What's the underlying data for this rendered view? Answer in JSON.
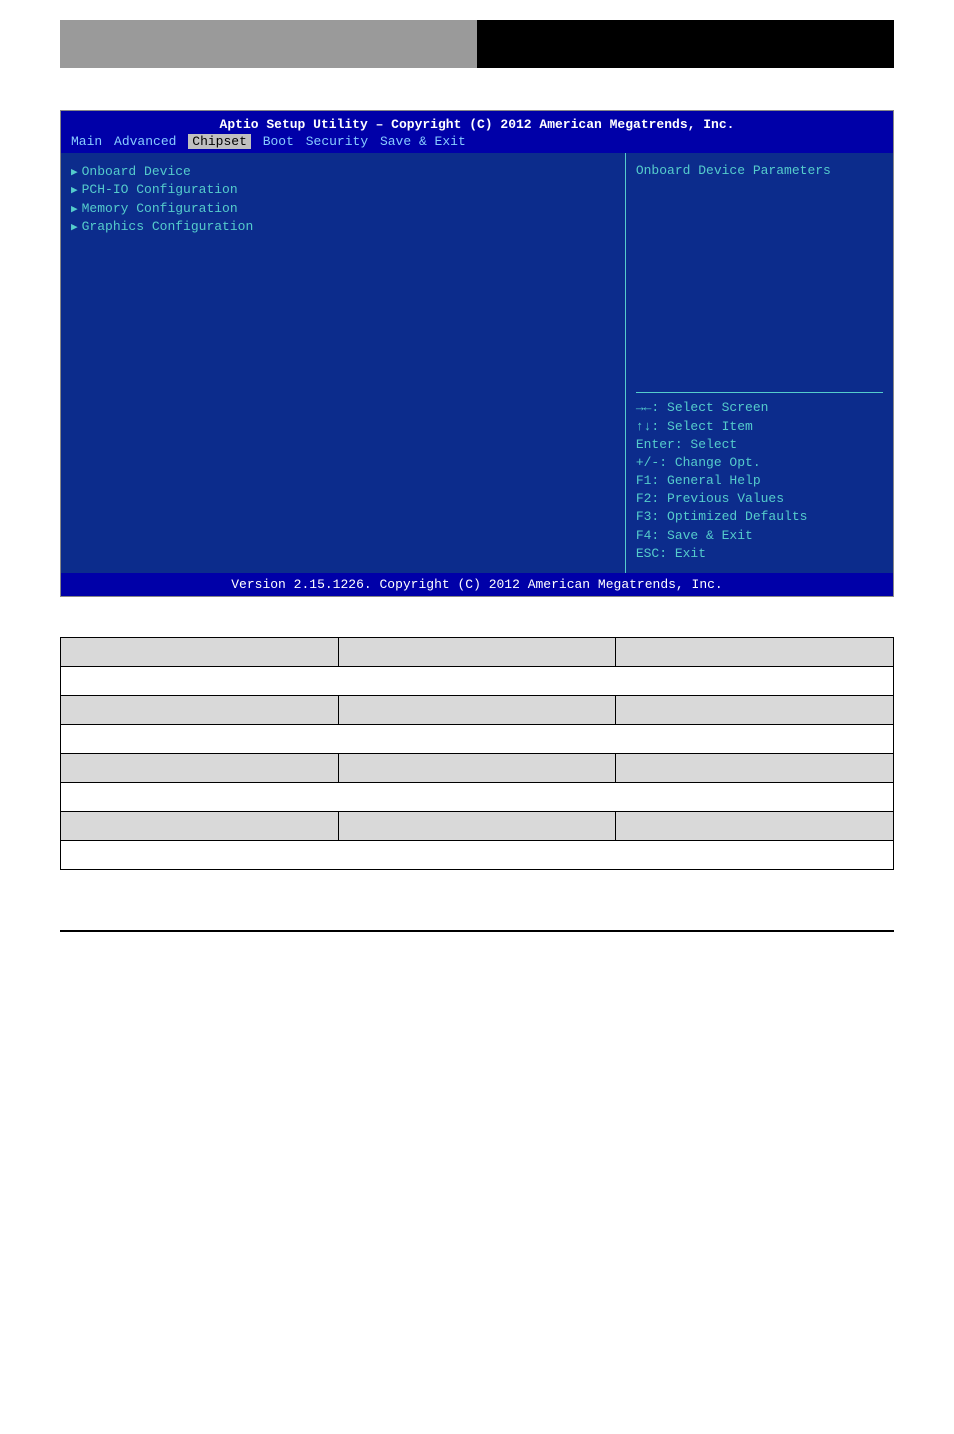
{
  "bios": {
    "title": "Aptio Setup Utility – Copyright (C) 2012 American Megatrends, Inc.",
    "menu": {
      "items": [
        "Main",
        "Advanced",
        "Chipset",
        "Boot",
        "Security",
        "Save & Exit"
      ],
      "active_index": 2
    },
    "left_items": [
      "Onboard Device",
      "PCH-IO Configuration",
      "Memory Configuration",
      "Graphics Configuration"
    ],
    "right_help": "Onboard Device Parameters",
    "keys": [
      "→←: Select Screen",
      "↑↓: Select Item",
      "Enter: Select",
      "+/-: Change Opt.",
      "F1: General Help",
      "F2: Previous Values",
      "F3: Optimized Defaults",
      "F4: Save & Exit",
      "ESC: Exit"
    ],
    "footer": "Version 2.15.1226. Copyright (C) 2012 American Megatrends, Inc."
  },
  "table": {
    "rows": [
      {
        "type": "header",
        "cells": [
          "",
          "",
          ""
        ]
      },
      {
        "type": "full",
        "cells": [
          ""
        ]
      },
      {
        "type": "header",
        "cells": [
          "",
          "",
          ""
        ]
      },
      {
        "type": "full",
        "cells": [
          ""
        ]
      },
      {
        "type": "header",
        "cells": [
          "",
          "",
          ""
        ]
      },
      {
        "type": "full",
        "cells": [
          ""
        ]
      },
      {
        "type": "header",
        "cells": [
          "",
          "",
          ""
        ]
      },
      {
        "type": "full",
        "cells": [
          ""
        ]
      }
    ]
  }
}
